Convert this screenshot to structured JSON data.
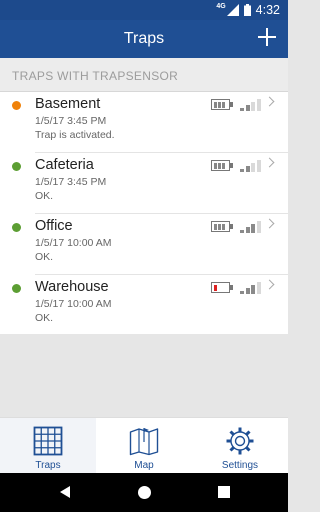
{
  "status_bar": {
    "network": "4G",
    "time": "4:32"
  },
  "app_bar": {
    "title": "Traps",
    "add_icon": "plus-icon"
  },
  "section": {
    "title": "TRAPS WITH TRAPSENSOR"
  },
  "colors": {
    "primary": "#1f4f94",
    "status_orange": "#f0820a",
    "status_green": "#5c9e33",
    "battery_low": "#dd2222"
  },
  "traps": [
    {
      "name": "Basement",
      "date": "1/5/17 3:45 PM",
      "status": "Trap is activated.",
      "indicator": "orange",
      "battery_level": 0.75,
      "signal_bars": 2
    },
    {
      "name": "Cafeteria",
      "date": "1/5/17 3:45 PM",
      "status": "OK.",
      "indicator": "green",
      "battery_level": 0.75,
      "signal_bars": 2
    },
    {
      "name": "Office",
      "date": "1/5/17 10:00 AM",
      "status": "OK.",
      "indicator": "green",
      "battery_level": 0.75,
      "signal_bars": 3
    },
    {
      "name": "Warehouse",
      "date": "1/5/17 10:00 AM",
      "status": "OK.",
      "indicator": "green",
      "battery_level": 0.25,
      "signal_bars": 3
    }
  ],
  "tabs": [
    {
      "label": "Traps",
      "icon": "grid-icon",
      "active": true
    },
    {
      "label": "Map",
      "icon": "map-icon",
      "active": false
    },
    {
      "label": "Settings",
      "icon": "gear-icon",
      "active": false
    }
  ]
}
